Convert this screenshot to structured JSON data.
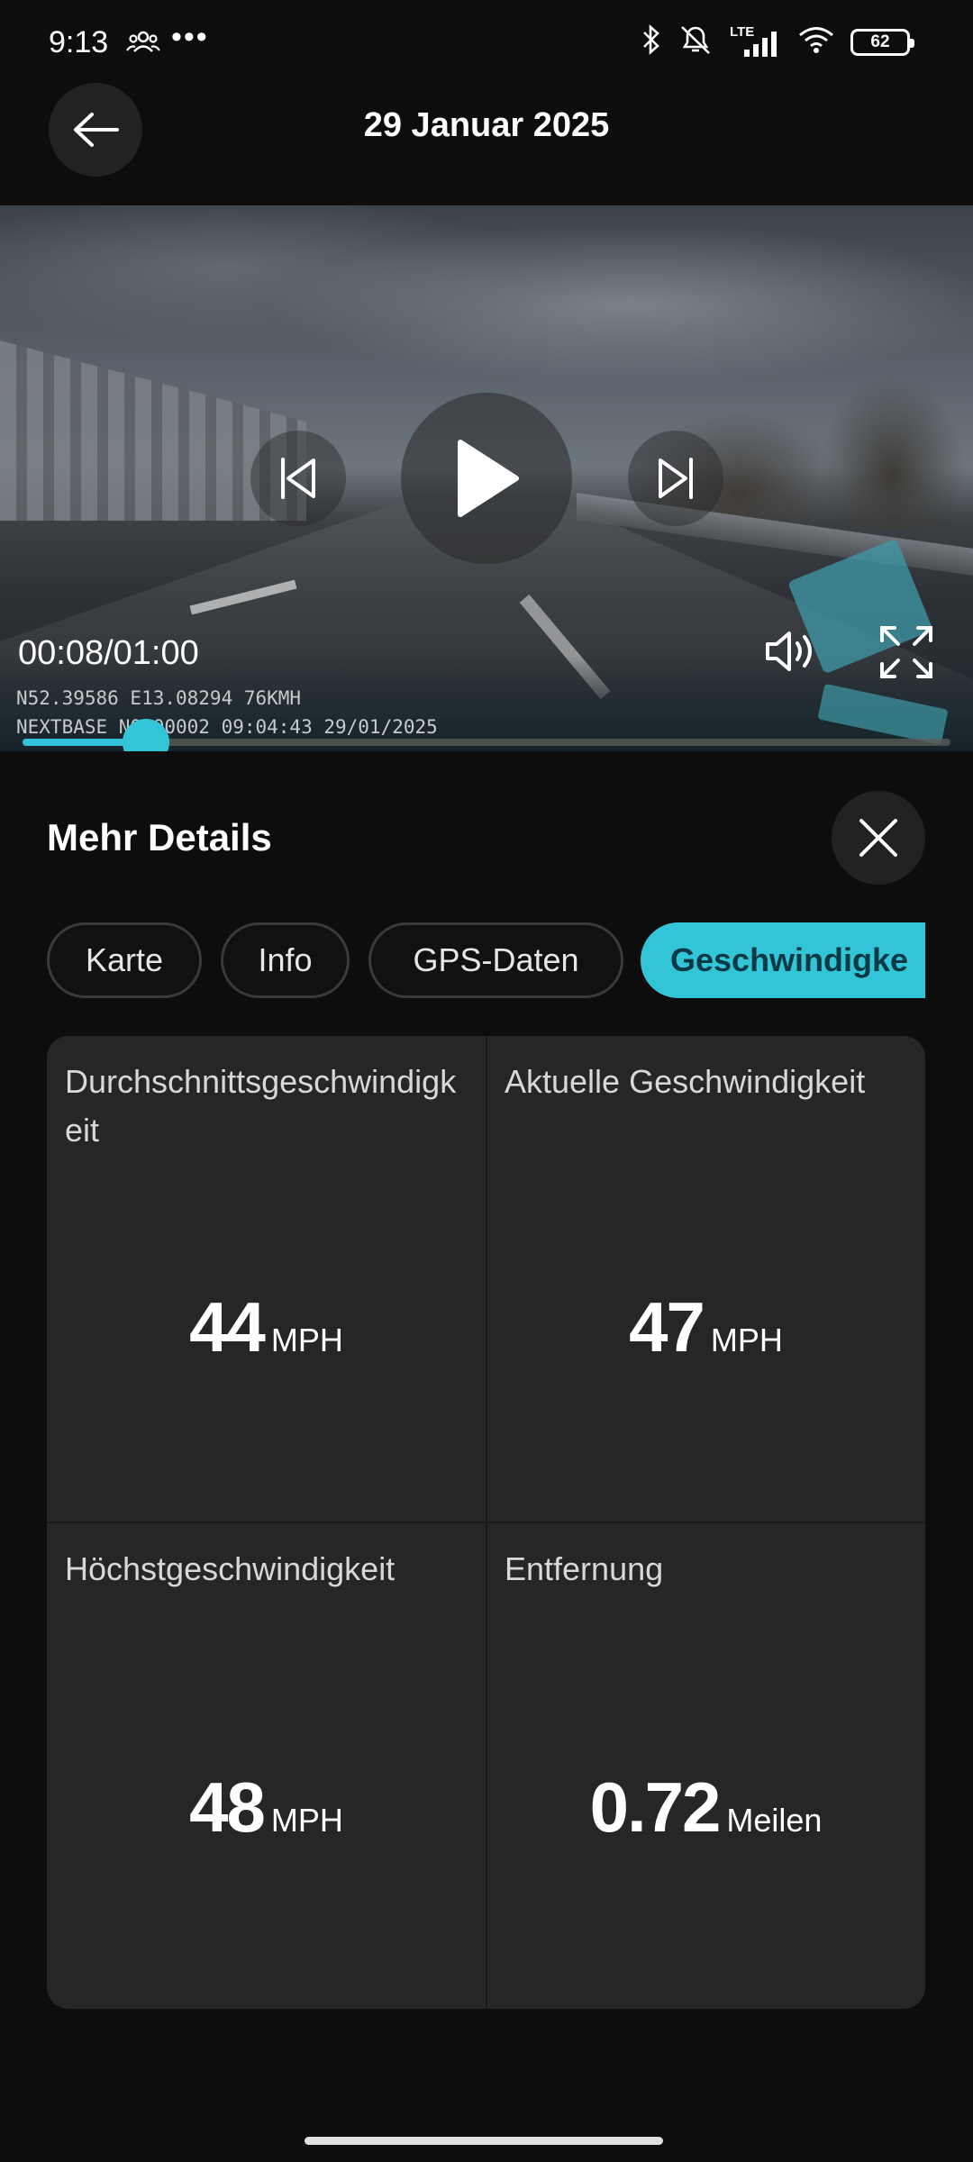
{
  "status_bar": {
    "time": "9:13",
    "dots": "•••",
    "network": "LTE",
    "battery": "62"
  },
  "header": {
    "title": "29 Januar 2025",
    "back_icon": "arrow-left-icon"
  },
  "video": {
    "time": "00:08/01:00",
    "overlay_line1": "N52.39586 E13.08294 76KMH",
    "overlay_line2": "NEXTBASE N0000002 09:04:43 29/01/2025",
    "progress": 0.133,
    "accent_color": "#32c5d8"
  },
  "details": {
    "title": "Mehr Details",
    "tabs": [
      {
        "label": "Karte",
        "active": false
      },
      {
        "label": "Info",
        "active": false
      },
      {
        "label": "GPS-Daten",
        "active": false
      },
      {
        "label": "Geschwindigke",
        "active": true
      }
    ],
    "stats": [
      {
        "label": "Durchschnittsgeschwindigkeit",
        "value": "44",
        "unit": "MPH"
      },
      {
        "label": "Aktuelle Geschwindigkeit",
        "value": "47",
        "unit": "MPH"
      },
      {
        "label": "Höchstgeschwindigkeit",
        "value": "48",
        "unit": "MPH"
      },
      {
        "label": "Entfernung",
        "value": "0.72",
        "unit": "Meilen"
      }
    ]
  }
}
